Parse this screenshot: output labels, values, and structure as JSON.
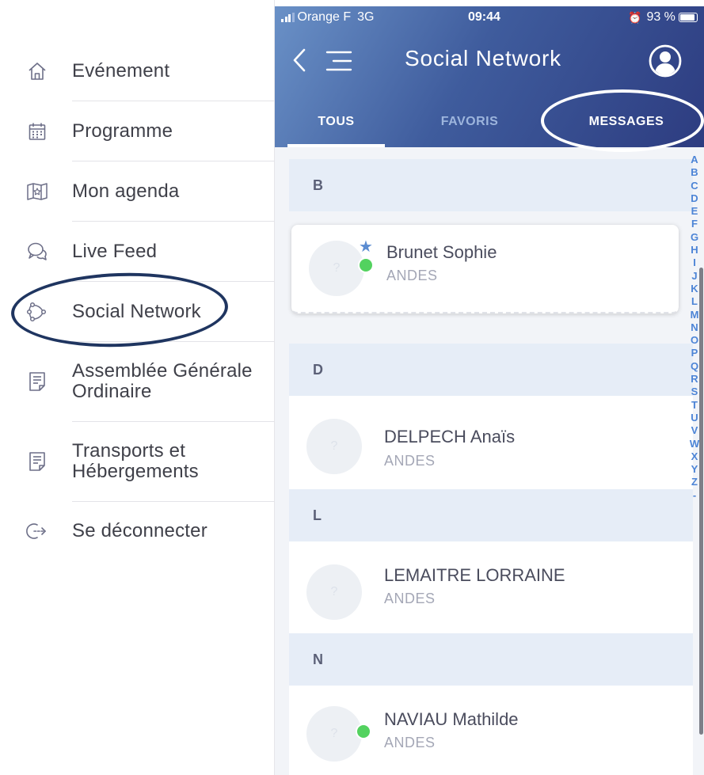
{
  "menu": {
    "items": [
      {
        "label": "Evénement",
        "icon": "home-icon"
      },
      {
        "label": "Programme",
        "icon": "calendar-icon"
      },
      {
        "label": "Mon agenda",
        "icon": "agenda-icon"
      },
      {
        "label": "Live Feed",
        "icon": "chat-bubbles-icon"
      },
      {
        "label": "Social Network",
        "icon": "network-icon"
      },
      {
        "label": "Assemblée Générale\nOrdinaire",
        "icon": "document-icon"
      },
      {
        "label": "Transports et\nHébergements",
        "icon": "document-icon"
      },
      {
        "label": "Se déconnecter",
        "icon": "logout-icon"
      }
    ]
  },
  "status_bar": {
    "carrier": "Orange F",
    "network": "3G",
    "time": "09:44",
    "battery": "93 %"
  },
  "header": {
    "title": "Social Network"
  },
  "tabs": [
    {
      "label": "TOUS",
      "active": true
    },
    {
      "label": "FAVORIS",
      "active": false
    },
    {
      "label": "MESSAGES",
      "active": false
    }
  ],
  "sections": [
    {
      "letter": "B",
      "contacts": [
        {
          "name": "Brunet Sophie",
          "company": "ANDES",
          "favorite": true,
          "online": true
        }
      ]
    },
    {
      "letter": "D",
      "contacts": [
        {
          "name": "DELPECH Anaïs",
          "company": "ANDES",
          "favorite": false,
          "online": false
        }
      ]
    },
    {
      "letter": "L",
      "contacts": [
        {
          "name": "LEMAITRE LORRAINE",
          "company": "ANDES",
          "favorite": false,
          "online": false
        }
      ]
    },
    {
      "letter": "N",
      "contacts": [
        {
          "name": "NAVIAU Mathilde",
          "company": "ANDES",
          "favorite": false,
          "online": true
        }
      ]
    }
  ],
  "avatar_placeholder": "?",
  "alphabet": [
    "A",
    "B",
    "C",
    "D",
    "E",
    "F",
    "G",
    "H",
    "I",
    "J",
    "K",
    "L",
    "M",
    "N",
    "O",
    "P",
    "Q",
    "R",
    "S",
    "T",
    "U",
    "V",
    "W",
    "X",
    "Y",
    "Z",
    "-"
  ],
  "colors": {
    "header_start": "#6a91c7",
    "header_end": "#2d3c80",
    "online": "#53d25f",
    "star": "#5b8cd1",
    "index_letters": "#4c84d6",
    "callout": "#1f3560"
  }
}
